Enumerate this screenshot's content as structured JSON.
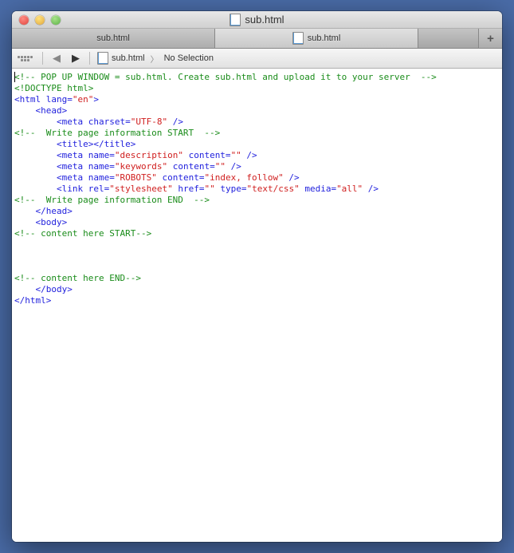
{
  "window": {
    "title": "sub.html"
  },
  "tabs": {
    "inactive_label": "sub.html",
    "active_label": "sub.html",
    "add_label": "+"
  },
  "pathbar": {
    "back_icon": "◀",
    "forward_icon": "▶",
    "file_label": "sub.html",
    "selection_label": "No Selection",
    "chevron": "〉"
  },
  "code": {
    "l1_a": "<!-- POP UP WINDOW = sub.html. Create sub.html and upload it to your server  -->",
    "l2_a": "<!DOCTYPE html>",
    "l3_a": "<html",
    "l3_b": " lang=",
    "l3_c": "\"en\"",
    "l3_d": ">",
    "l4_a": "    ",
    "l4_b": "<head>",
    "l5_a": "        ",
    "l5_b": "<meta",
    "l5_c": " charset=",
    "l5_d": "\"UTF-8\"",
    "l5_e": " />",
    "l6_a": "<!--  Write page information START  -->",
    "l7_a": "        ",
    "l7_b": "<title></title>",
    "l8_a": "        ",
    "l8_b": "<meta",
    "l8_c": " name=",
    "l8_d": "\"description\"",
    "l8_e": " content=",
    "l8_f": "\"\"",
    "l8_g": " />",
    "l9_a": "        ",
    "l9_b": "<meta",
    "l9_c": " name=",
    "l9_d": "\"keywords\"",
    "l9_e": " content=",
    "l9_f": "\"\"",
    "l9_g": " />",
    "l10_a": "        ",
    "l10_b": "<meta",
    "l10_c": " name=",
    "l10_d": "\"ROBOTS\"",
    "l10_e": " content=",
    "l10_f": "\"index, follow\"",
    "l10_g": " />",
    "l11_a": "        ",
    "l11_b": "<link",
    "l11_c": " rel=",
    "l11_d": "\"stylesheet\"",
    "l11_e": " href=",
    "l11_f": "\"\"",
    "l11_g": " type=",
    "l11_h": "\"text/css\"",
    "l11_i": " media=",
    "l11_j": "\"all\"",
    "l11_k": " />",
    "l12_a": "<!--  Write page information END  -->",
    "l13_a": "    ",
    "l13_b": "</head>",
    "l14_a": "    ",
    "l14_b": "<body>",
    "l15_a": "<!-- content here START-->",
    "l19_a": "<!-- content here END-->",
    "l20_a": "    ",
    "l20_b": "</body>",
    "l21_a": "</html>"
  }
}
